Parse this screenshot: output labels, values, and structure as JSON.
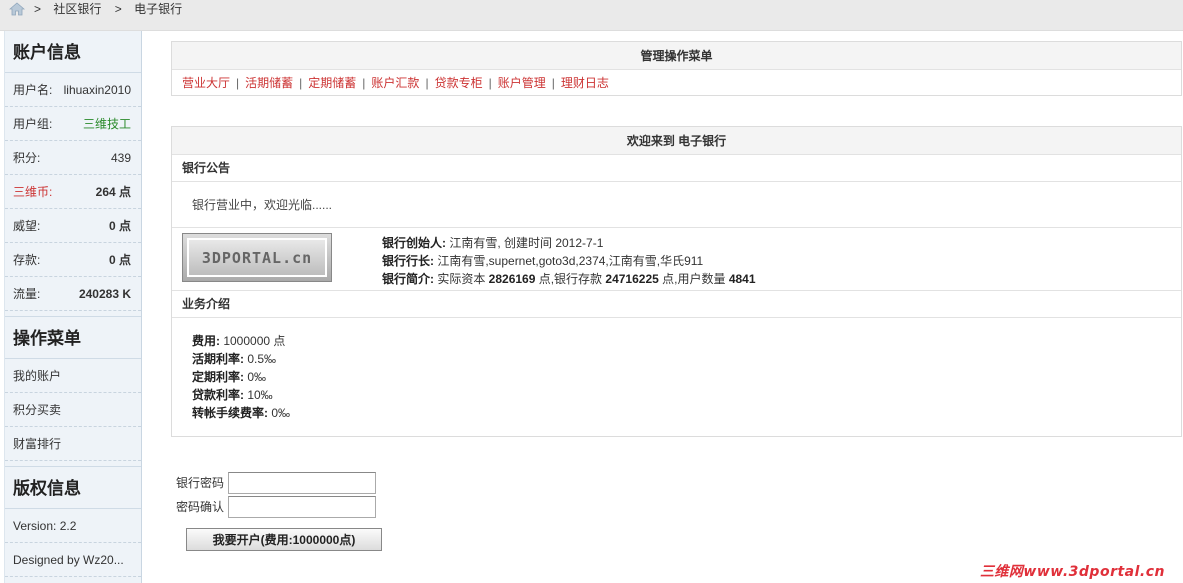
{
  "breadcrumb": {
    "sep": ">",
    "items": [
      "社区银行",
      "电子银行"
    ]
  },
  "sidebar": {
    "account_title": "账户信息",
    "rows": [
      {
        "label": "用户名:",
        "value": "lihuaxin2010"
      },
      {
        "label": "用户组:",
        "value": "三维技工"
      },
      {
        "label": "积分:",
        "value": "439"
      },
      {
        "label": "三维币:",
        "value": "264 点"
      },
      {
        "label": "威望:",
        "value": "0 点"
      },
      {
        "label": "存款:",
        "value": "0 点"
      },
      {
        "label": "流量:",
        "value": "240283 K"
      }
    ],
    "menu_title": "操作菜单",
    "menu": [
      "我的账户",
      "积分买卖",
      "财富排行"
    ],
    "copyright_title": "版权信息",
    "copyright": [
      "Version: 2.2",
      "Designed by Wz20..."
    ]
  },
  "manage": {
    "title": "管理操作菜单",
    "bar": "|",
    "links": [
      "营业大厅",
      "活期储蓄",
      "定期储蓄",
      "账户汇款",
      "贷款专柜",
      "账户管理",
      "理财日志"
    ]
  },
  "welcome": {
    "title": "欢迎来到 电子银行",
    "notice_head": "银行公告",
    "notice": "银行营业中，欢迎光临......",
    "logo_text": "3DPORTAL.cn",
    "founder_label": "银行创始人:",
    "founder_value": " 江南有雪, 创建时间 2012-7-1",
    "president_label": "银行行长:",
    "president_value": " 江南有雪,supernet,goto3d,2374,江南有雪,华氏911",
    "intro_label": "银行简介:",
    "intro_capital_pre": " 实际资本 ",
    "intro_capital": "2826169",
    "intro_deposit_pre": " 点,银行存款 ",
    "intro_deposit": "24716225",
    "intro_users_pre": " 点,用户数量 ",
    "intro_users": "4841",
    "biz_head": "业务介绍",
    "biz": [
      {
        "label": "费用:",
        "value": " 1000000 点"
      },
      {
        "label": "活期利率:",
        "value": " 0.5‰"
      },
      {
        "label": "定期利率:",
        "value": " 0‰"
      },
      {
        "label": "贷款利率:",
        "value": " 10‰"
      },
      {
        "label": "转帐手续费率:",
        "value": " 0‰"
      }
    ]
  },
  "form": {
    "password_label": "银行密码",
    "confirm_label": "密码确认",
    "submit": "我要开户(费用:1000000点)"
  },
  "watermark": "三维网www.3dportal.cn"
}
